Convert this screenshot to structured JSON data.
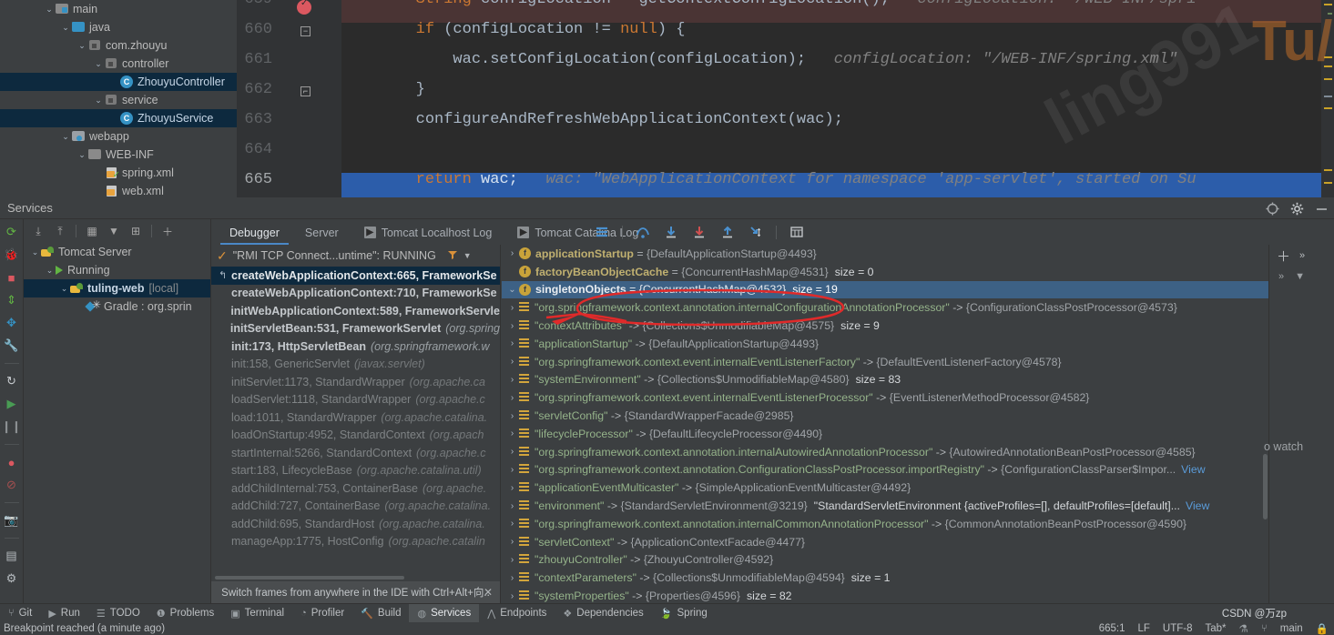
{
  "project_tree": {
    "rows": [
      {
        "indent": 60,
        "arrow": "⌄",
        "icon": "folder-src-icon",
        "label": "main",
        "selected": false
      },
      {
        "indent": 78,
        "arrow": "⌄",
        "icon": "folder-java-icon",
        "label": "java",
        "selected": false
      },
      {
        "indent": 96,
        "arrow": "⌄",
        "icon": "package-icon",
        "label": "com.zhouyu",
        "selected": false
      },
      {
        "indent": 114,
        "arrow": "⌄",
        "icon": "package-icon",
        "label": "controller",
        "selected": false
      },
      {
        "indent": 132,
        "arrow": "",
        "icon": "java-class-icon",
        "label": "ZhouyuController",
        "selected": true
      },
      {
        "indent": 114,
        "arrow": "⌄",
        "icon": "package-icon",
        "label": "service",
        "selected": false
      },
      {
        "indent": 132,
        "arrow": "",
        "icon": "java-class-icon",
        "label": "ZhouyuService",
        "selected": true
      },
      {
        "indent": 78,
        "arrow": "⌄",
        "icon": "webapp-folder-icon",
        "label": "webapp",
        "selected": false
      },
      {
        "indent": 96,
        "arrow": "⌄",
        "icon": "folder-icon",
        "label": "WEB-INF",
        "selected": false
      },
      {
        "indent": 114,
        "arrow": "",
        "icon": "xml-file-icon",
        "label": "spring.xml",
        "selected": false
      },
      {
        "indent": 114,
        "arrow": "",
        "icon": "xml-file-icon",
        "label": "web.xml",
        "selected": false
      }
    ]
  },
  "editor": {
    "line_numbers": [
      "659",
      "660",
      "661",
      "662",
      "663",
      "664",
      "665"
    ],
    "lines": [
      {
        "code": "        String configLocation = getContextConfigLocation();",
        "inline_hint": "configLocation: \"/WEB-INF/spri"
      },
      {
        "code": "        if (configLocation != null) {",
        "inline_hint": ""
      },
      {
        "code": "            wac.setConfigLocation(configLocation);",
        "inline_hint": "configLocation: \"/WEB-INF/spring.xml\""
      },
      {
        "code": "        }",
        "inline_hint": ""
      },
      {
        "code": "        configureAndRefreshWebApplicationContext(wac);",
        "inline_hint": ""
      },
      {
        "code": "",
        "inline_hint": ""
      },
      {
        "code": "        return wac;",
        "inline_hint": "wac: \"WebApplicationContext for namespace 'app-servlet', started on Su"
      }
    ],
    "watermark_primary": "Tu/ng",
    "watermark_secondary": "ling991"
  },
  "services": {
    "title": "Services",
    "run_toolbar": [
      {
        "name": "rerun-icon",
        "glyph": "⟳"
      },
      {
        "name": "debug-icon",
        "glyph": "🐞"
      },
      {
        "name": "stop-icon",
        "glyph": "■"
      },
      {
        "name": "update-icon",
        "glyph": "⇕"
      },
      {
        "name": "deploy-icon",
        "glyph": "✥"
      },
      {
        "name": "settings-wrench-icon",
        "glyph": "🔧"
      },
      {
        "name": "restart-icon",
        "glyph": "↻"
      },
      {
        "name": "resume-program-icon",
        "glyph": "▶"
      },
      {
        "name": "pause-program-icon",
        "glyph": "❙❙"
      },
      {
        "name": "view-breakpoints-icon",
        "glyph": "●"
      },
      {
        "name": "mute-breakpoints-icon",
        "glyph": "⊘"
      },
      {
        "name": "camera-icon",
        "glyph": "📷"
      },
      {
        "name": "layout-icon",
        "glyph": "▤"
      },
      {
        "name": "gear-icon",
        "glyph": "⚙"
      }
    ],
    "tree_toolbar": [
      {
        "name": "expand-all-icon",
        "glyph": "⤓"
      },
      {
        "name": "collapse-all-icon",
        "glyph": "⤒"
      },
      {
        "name": "group-by-icon",
        "glyph": "▦"
      },
      {
        "name": "filter-icon",
        "glyph": "▼"
      },
      {
        "name": "add-tab-icon",
        "glyph": "⊞"
      },
      {
        "name": "add-service-icon",
        "glyph": "＋"
      }
    ],
    "tree": [
      {
        "indent": 6,
        "arrow": "⌄",
        "icon": "tomcat-icon",
        "label": "Tomcat Server",
        "suffix": "",
        "selected": false,
        "bold": false
      },
      {
        "indent": 22,
        "arrow": "⌄",
        "icon": "run-play-icon",
        "label": "Running",
        "suffix": "",
        "selected": false,
        "bold": false
      },
      {
        "indent": 38,
        "arrow": "⌄",
        "icon": "tomcat-icon",
        "label": "tuling-web",
        "suffix": "[local]",
        "selected": true,
        "bold": true
      },
      {
        "indent": 56,
        "arrow": "",
        "icon": "gradle-icon",
        "label": "Gradle : org.sprin",
        "suffix": "",
        "selected": false,
        "bold": false
      }
    ]
  },
  "debugger": {
    "tabs": [
      {
        "label": "Debugger",
        "icon": "",
        "active": true
      },
      {
        "label": "Server",
        "icon": "",
        "active": false
      },
      {
        "label": "Tomcat Localhost Log",
        "icon": "console-icon",
        "active": false
      },
      {
        "label": "Tomcat Catalina Log",
        "icon": "console-icon",
        "active": false
      }
    ],
    "toolbar": [
      {
        "name": "show-execution-point-icon",
        "glyph": "≡"
      },
      {
        "name": "step-over-icon",
        "glyph": "⤻"
      },
      {
        "name": "step-into-icon",
        "glyph": "↓"
      },
      {
        "name": "force-step-into-icon",
        "glyph": "↓"
      },
      {
        "name": "step-out-icon",
        "glyph": "↑"
      },
      {
        "name": "run-to-cursor-icon",
        "glyph": "↳"
      },
      {
        "name": "evaluate-expression-icon",
        "glyph": "▦"
      }
    ],
    "thread_label": "\"RMI TCP Connect...untime\": RUNNING",
    "frames": [
      {
        "method": "createWebApplicationContext:665, FrameworkSe",
        "package": "",
        "selected": true,
        "dim": false,
        "return_arrow": true
      },
      {
        "method": "createWebApplicationContext:710, FrameworkSe",
        "package": "",
        "selected": false,
        "dim": false,
        "return_arrow": false
      },
      {
        "method": "initWebApplicationContext:589, FrameworkServle",
        "package": "",
        "selected": false,
        "dim": false,
        "return_arrow": false
      },
      {
        "method": "initServletBean:531, FrameworkServlet",
        "package": "(org.spring",
        "selected": false,
        "dim": false,
        "return_arrow": false
      },
      {
        "method": "init:173, HttpServletBean",
        "package": "(org.springframework.w",
        "selected": false,
        "dim": false,
        "return_arrow": false
      },
      {
        "method": "init:158, GenericServlet",
        "package": "(javax.servlet)",
        "selected": false,
        "dim": true,
        "return_arrow": false
      },
      {
        "method": "initServlet:1173, StandardWrapper",
        "package": "(org.apache.ca",
        "selected": false,
        "dim": true,
        "return_arrow": false
      },
      {
        "method": "loadServlet:1118, StandardWrapper",
        "package": "(org.apache.c",
        "selected": false,
        "dim": true,
        "return_arrow": false
      },
      {
        "method": "load:1011, StandardWrapper",
        "package": "(org.apache.catalina.",
        "selected": false,
        "dim": true,
        "return_arrow": false
      },
      {
        "method": "loadOnStartup:4952, StandardContext",
        "package": "(org.apach",
        "selected": false,
        "dim": true,
        "return_arrow": false
      },
      {
        "method": "startInternal:5266, StandardContext",
        "package": "(org.apache.c",
        "selected": false,
        "dim": true,
        "return_arrow": false
      },
      {
        "method": "start:183, LifecycleBase",
        "package": "(org.apache.catalina.util)",
        "selected": false,
        "dim": true,
        "return_arrow": false
      },
      {
        "method": "addChildInternal:753, ContainerBase",
        "package": "(org.apache.",
        "selected": false,
        "dim": true,
        "return_arrow": false
      },
      {
        "method": "addChild:727, ContainerBase",
        "package": "(org.apache.catalina.",
        "selected": false,
        "dim": true,
        "return_arrow": false
      },
      {
        "method": "addChild:695, StandardHost",
        "package": "(org.apache.catalina.",
        "selected": false,
        "dim": true,
        "return_arrow": false
      },
      {
        "method": "manageApp:1775, HostConfig",
        "package": "(org.apache.catalin",
        "selected": false,
        "dim": true,
        "return_arrow": false
      }
    ],
    "frames_hint": "Switch frames from anywhere in the IDE with Ctrl+Alt+向..",
    "variables": [
      {
        "arrow": "›",
        "icon": "field-icon",
        "name": "applicationStartup",
        "sep": " = ",
        "value": "{DefaultApplicationStartup@4493}",
        "size": "",
        "view": "",
        "selected": false,
        "kind": "field"
      },
      {
        "arrow": "",
        "icon": "field-icon",
        "name": "factoryBeanObjectCache",
        "sep": " = ",
        "value": "{ConcurrentHashMap@4531}",
        "size": "size = 0",
        "view": "",
        "selected": false,
        "kind": "field"
      },
      {
        "arrow": "⌄",
        "icon": "field-icon",
        "name": "singletonObjects",
        "sep": " = ",
        "value": "{ConcurrentHashMap@4532}",
        "size": "size = 19",
        "view": "",
        "selected": true,
        "kind": "field"
      },
      {
        "arrow": "›",
        "icon": "entry-icon",
        "name": "\"org.springframework.context.annotation.internalConfigurationAnnotationProcessor\"",
        "sep": " -> ",
        "value": "{ConfigurationClassPostProcessor@4573}",
        "size": "",
        "view": "",
        "selected": false,
        "kind": "entry"
      },
      {
        "arrow": "›",
        "icon": "entry-icon",
        "name": "\"contextAttributes\"",
        "sep": " -> ",
        "value": "{Collections$UnmodifiableMap@4575}",
        "size": "size = 9",
        "view": "",
        "selected": false,
        "kind": "entry"
      },
      {
        "arrow": "›",
        "icon": "entry-icon",
        "name": "\"applicationStartup\"",
        "sep": " -> ",
        "value": "{DefaultApplicationStartup@4493}",
        "size": "",
        "view": "",
        "selected": false,
        "kind": "entry"
      },
      {
        "arrow": "›",
        "icon": "entry-icon",
        "name": "\"org.springframework.context.event.internalEventListenerFactory\"",
        "sep": " -> ",
        "value": "{DefaultEventListenerFactory@4578}",
        "size": "",
        "view": "",
        "selected": false,
        "kind": "entry"
      },
      {
        "arrow": "›",
        "icon": "entry-icon",
        "name": "\"systemEnvironment\"",
        "sep": " -> ",
        "value": "{Collections$UnmodifiableMap@4580}",
        "size": "size = 83",
        "view": "",
        "selected": false,
        "kind": "entry"
      },
      {
        "arrow": "›",
        "icon": "entry-icon",
        "name": "\"org.springframework.context.event.internalEventListenerProcessor\"",
        "sep": " -> ",
        "value": "{EventListenerMethodProcessor@4582}",
        "size": "",
        "view": "",
        "selected": false,
        "kind": "entry"
      },
      {
        "arrow": "›",
        "icon": "entry-icon",
        "name": "\"servletConfig\"",
        "sep": " -> ",
        "value": "{StandardWrapperFacade@2985}",
        "size": "",
        "view": "",
        "selected": false,
        "kind": "entry"
      },
      {
        "arrow": "›",
        "icon": "entry-icon",
        "name": "\"lifecycleProcessor\"",
        "sep": " -> ",
        "value": "{DefaultLifecycleProcessor@4490}",
        "size": "",
        "view": "",
        "selected": false,
        "kind": "entry"
      },
      {
        "arrow": "›",
        "icon": "entry-icon",
        "name": "\"org.springframework.context.annotation.internalAutowiredAnnotationProcessor\"",
        "sep": " -> ",
        "value": "{AutowiredAnnotationBeanPostProcessor@4585}",
        "size": "",
        "view": "",
        "selected": false,
        "kind": "entry"
      },
      {
        "arrow": "›",
        "icon": "entry-icon",
        "name": "\"org.springframework.context.annotation.ConfigurationClassPostProcessor.importRegistry\"",
        "sep": " -> ",
        "value": "{ConfigurationClassParser$Impor...",
        "size": "",
        "view": "View",
        "selected": false,
        "kind": "entry"
      },
      {
        "arrow": "›",
        "icon": "entry-icon",
        "name": "\"applicationEventMulticaster\"",
        "sep": " -> ",
        "value": "{SimpleApplicationEventMulticaster@4492}",
        "size": "",
        "view": "",
        "selected": false,
        "kind": "entry"
      },
      {
        "arrow": "›",
        "icon": "entry-icon",
        "name": "\"environment\"",
        "sep": " -> ",
        "value": "{StandardServletEnvironment@3219}",
        "size": "\"StandardServletEnvironment {activeProfiles=[], defaultProfiles=[default]...",
        "view": "View",
        "selected": false,
        "kind": "entry"
      },
      {
        "arrow": "›",
        "icon": "entry-icon",
        "name": "\"org.springframework.context.annotation.internalCommonAnnotationProcessor\"",
        "sep": " -> ",
        "value": "{CommonAnnotationBeanPostProcessor@4590}",
        "size": "",
        "view": "",
        "selected": false,
        "kind": "entry"
      },
      {
        "arrow": "›",
        "icon": "entry-icon",
        "name": "\"servletContext\"",
        "sep": " -> ",
        "value": "{ApplicationContextFacade@4477}",
        "size": "",
        "view": "",
        "selected": false,
        "kind": "entry"
      },
      {
        "arrow": "›",
        "icon": "entry-icon",
        "name": "\"zhouyuController\"",
        "sep": " -> ",
        "value": "{ZhouyuController@4592}",
        "size": "",
        "view": "",
        "selected": false,
        "kind": "entry"
      },
      {
        "arrow": "›",
        "icon": "entry-icon",
        "name": "\"contextParameters\"",
        "sep": " -> ",
        "value": "{Collections$UnmodifiableMap@4594}",
        "size": "size = 1",
        "view": "",
        "selected": false,
        "kind": "entry"
      },
      {
        "arrow": "›",
        "icon": "entry-icon",
        "name": "\"systemProperties\"",
        "sep": " -> ",
        "value": "{Properties@4596}",
        "size": "size = 82",
        "view": "",
        "selected": false,
        "kind": "entry"
      }
    ],
    "watches_placeholder": "o watch",
    "watch_add_label": "＋",
    "watch_more_label": "»",
    "watch_chevron_label": "▼"
  },
  "bottom_toolbar": [
    {
      "label": "Git",
      "icon": "branch-icon",
      "glyph": "⑂",
      "active": false
    },
    {
      "label": "Run",
      "icon": "run-icon",
      "glyph": "▶",
      "active": false
    },
    {
      "label": "TODO",
      "icon": "todo-icon",
      "glyph": "☰",
      "active": false
    },
    {
      "label": "Problems",
      "icon": "problems-icon",
      "glyph": "❶",
      "active": false
    },
    {
      "label": "Terminal",
      "icon": "terminal-icon",
      "glyph": "▣",
      "active": false
    },
    {
      "label": "Profiler",
      "icon": "profiler-icon",
      "glyph": "◔",
      "active": false
    },
    {
      "label": "Build",
      "icon": "build-icon",
      "glyph": "🔨",
      "active": false
    },
    {
      "label": "Services",
      "icon": "services-icon",
      "glyph": "◍",
      "active": true
    },
    {
      "label": "Endpoints",
      "icon": "endpoints-icon",
      "glyph": "⋀",
      "active": false
    },
    {
      "label": "Dependencies",
      "icon": "dependencies-icon",
      "glyph": "❖",
      "active": false
    },
    {
      "label": "Spring",
      "icon": "spring-icon",
      "glyph": "🍃",
      "active": false
    }
  ],
  "status_bar": {
    "message": "Breakpoint reached (a minute ago)",
    "caret": "665:1",
    "line_separator": "LF",
    "encoding": "UTF-8",
    "indent": "Tab*",
    "branch": "main",
    "watermark": "CSDN @万zp"
  },
  "colors": {
    "accent_blue": "#3592c4",
    "selection_blue": "#3d6185",
    "tree_selection": "#0d293e",
    "breakpoint_red": "#db5860",
    "current_line_blue": "#2c5daa",
    "annotation_red": "#e03030",
    "string_green": "#6a8759",
    "keyword_orange": "#cc7832"
  }
}
